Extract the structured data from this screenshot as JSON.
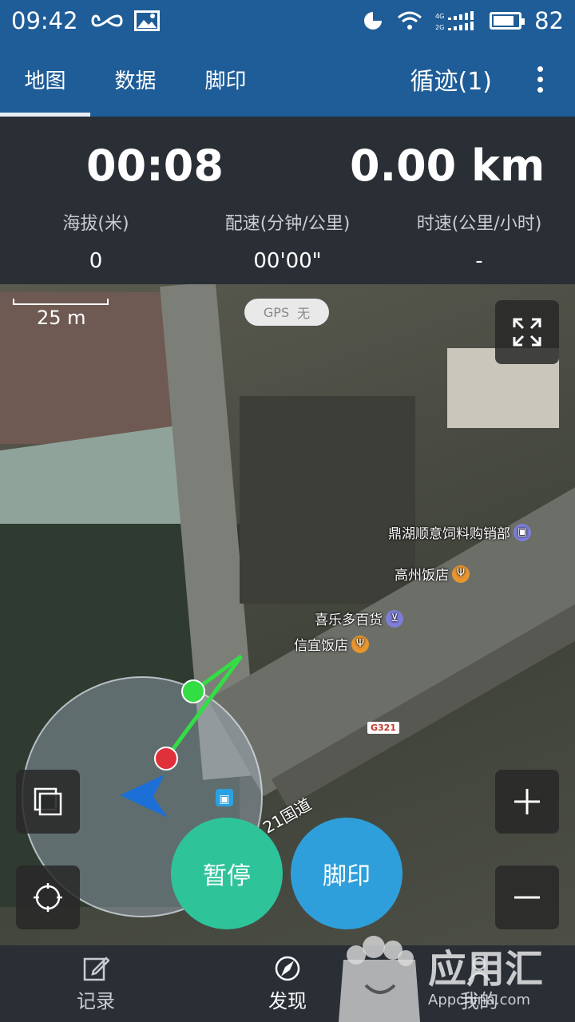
{
  "status_bar": {
    "time": "09:42",
    "battery": "82",
    "battery_level_percent": 82,
    "icons": [
      "infinity-icon",
      "image-icon",
      "pie-icon",
      "wifi-icon",
      "signal-icon",
      "battery-icon"
    ]
  },
  "app_bar": {
    "tabs": [
      {
        "label": "地图",
        "active": true
      },
      {
        "label": "数据",
        "active": false
      },
      {
        "label": "脚印",
        "active": false
      }
    ],
    "trace_label": "循迹(1)",
    "more_icon": "more-vertical-icon"
  },
  "stats": {
    "elapsed": "00:08",
    "distance": "0.00 km",
    "metrics": [
      {
        "label": "海拔(米)",
        "value": "0"
      },
      {
        "label": "配速(分钟/公里)",
        "value": "00'00\""
      },
      {
        "label": "时速(公里/小时)",
        "value": "-"
      }
    ]
  },
  "map": {
    "scale_label": "25 m",
    "gps": {
      "label": "GPS",
      "status": "无"
    },
    "pois": [
      {
        "name": "鼎湖顺意饲料购销部",
        "icon": "shop-icon",
        "color": "#7d7fd6"
      },
      {
        "name": "高州饭店",
        "icon": "restaurant-icon",
        "color": "#e8952f"
      },
      {
        "name": "喜乐多百货",
        "icon": "cart-icon",
        "color": "#7d7fd6"
      },
      {
        "name": "信宜饭店",
        "icon": "restaurant-icon",
        "color": "#e8952f"
      }
    ],
    "road_sign": "G321",
    "road_name": "21国道",
    "pause_label": "暂停",
    "footprint_label": "脚印",
    "accent_colors": {
      "pause": "#2fc39a",
      "footprint": "#2f9fdb",
      "track": "#33dd44",
      "start": "#e0303a",
      "heading": "#1c6fd6"
    }
  },
  "bottom_nav": [
    {
      "label": "记录",
      "icon": "edit-icon",
      "active": false
    },
    {
      "label": "发现",
      "icon": "compass-icon",
      "active": true
    },
    {
      "label": "我的",
      "icon": "user-icon",
      "active": false
    }
  ],
  "watermark": {
    "brand": "应用汇",
    "url": "Appchina.com"
  }
}
